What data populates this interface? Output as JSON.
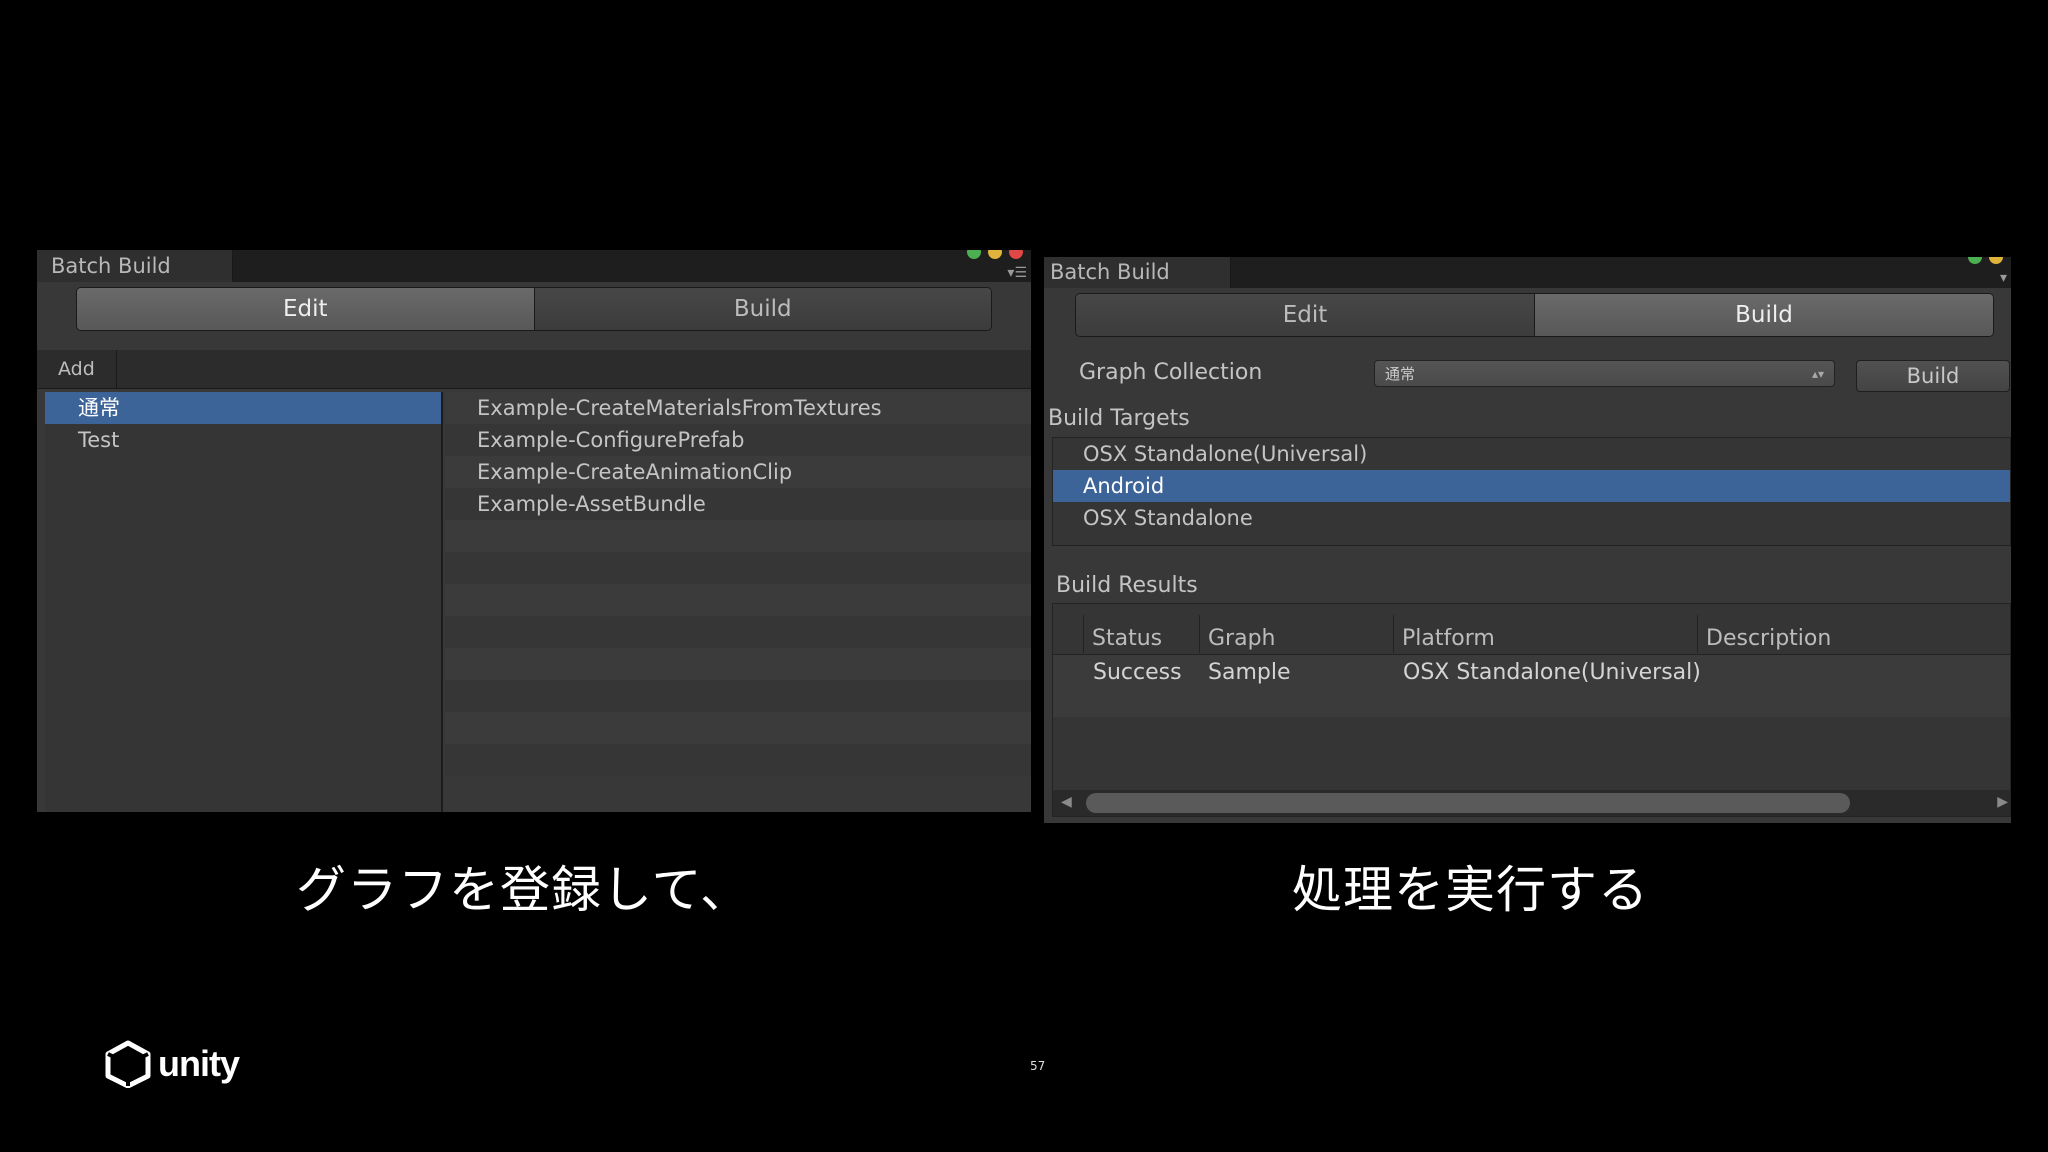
{
  "left_window": {
    "tab_title": "Batch Build",
    "tabs": [
      {
        "label": "Edit",
        "active": true
      },
      {
        "label": "Build",
        "active": false
      }
    ],
    "add_label": "Add",
    "graph_list": [
      {
        "label": "通常",
        "selected": true
      },
      {
        "label": "Test",
        "selected": false
      }
    ],
    "node_list": [
      "Example-CreateMaterialsFromTextures",
      "Example-ConfigurePrefab",
      "Example-CreateAnimationClip",
      "Example-AssetBundle",
      "",
      "",
      "",
      "",
      "",
      "",
      "",
      ""
    ]
  },
  "right_window": {
    "tab_title": "Batch Build",
    "tabs": [
      {
        "label": "Edit",
        "active": false
      },
      {
        "label": "Build",
        "active": true
      }
    ],
    "graph_collection_label": "Graph Collection",
    "graph_collection_value": "通常",
    "build_button": "Build",
    "build_targets_label": "Build Targets",
    "build_targets": [
      {
        "label": "OSX Standalone(Universal)",
        "selected": false
      },
      {
        "label": "Android",
        "selected": true
      },
      {
        "label": "OSX Standalone",
        "selected": false
      }
    ],
    "build_results_label": "Build Results",
    "results_columns": [
      "Status",
      "Graph",
      "Platform",
      "Description"
    ],
    "results_rows": [
      {
        "status": "Success",
        "graph": "Sample",
        "platform": "OSX Standalone(Universal)",
        "description": ""
      }
    ]
  },
  "captions": {
    "left": "グラフを登録して、",
    "right": "処理を実行する"
  },
  "logo_text": "unity",
  "page_number": "57",
  "colors": {
    "selection": "#3d6499",
    "background": "#000000",
    "panel": "#383838"
  }
}
